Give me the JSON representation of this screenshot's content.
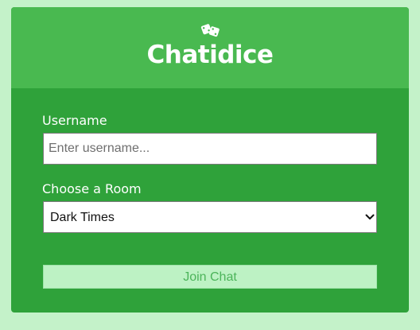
{
  "app": {
    "title": "Chatidice",
    "icon": "dice-icon"
  },
  "form": {
    "username_label": "Username",
    "username_placeholder": "Enter username...",
    "username_value": "",
    "room_label": "Choose a Room",
    "room_selected": "Dark Times",
    "join_label": "Join Chat"
  },
  "colors": {
    "page_background": "#c4f2c9",
    "header_green": "#49b950",
    "form_green": "#2fa23a",
    "button_background": "#bdf2c4",
    "button_text": "#4cb45a"
  }
}
